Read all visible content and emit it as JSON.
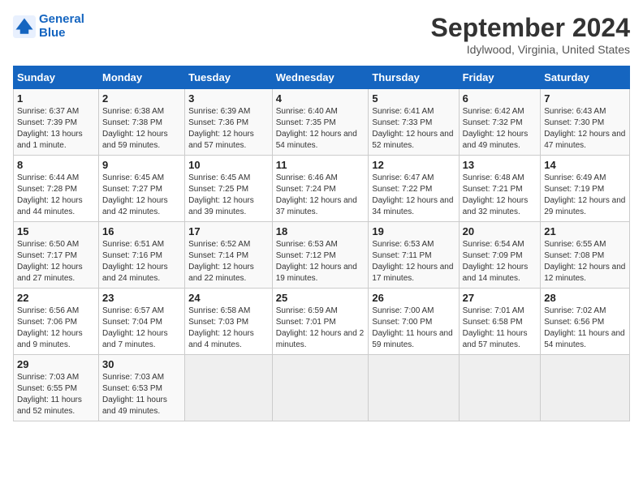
{
  "logo": {
    "line1": "General",
    "line2": "Blue"
  },
  "title": "September 2024",
  "subtitle": "Idylwood, Virginia, United States",
  "days_of_week": [
    "Sunday",
    "Monday",
    "Tuesday",
    "Wednesday",
    "Thursday",
    "Friday",
    "Saturday"
  ],
  "weeks": [
    [
      {
        "day": "1",
        "sunrise": "6:37 AM",
        "sunset": "7:39 PM",
        "daylight": "13 hours and 1 minute."
      },
      {
        "day": "2",
        "sunrise": "6:38 AM",
        "sunset": "7:38 PM",
        "daylight": "12 hours and 59 minutes."
      },
      {
        "day": "3",
        "sunrise": "6:39 AM",
        "sunset": "7:36 PM",
        "daylight": "12 hours and 57 minutes."
      },
      {
        "day": "4",
        "sunrise": "6:40 AM",
        "sunset": "7:35 PM",
        "daylight": "12 hours and 54 minutes."
      },
      {
        "day": "5",
        "sunrise": "6:41 AM",
        "sunset": "7:33 PM",
        "daylight": "12 hours and 52 minutes."
      },
      {
        "day": "6",
        "sunrise": "6:42 AM",
        "sunset": "7:32 PM",
        "daylight": "12 hours and 49 minutes."
      },
      {
        "day": "7",
        "sunrise": "6:43 AM",
        "sunset": "7:30 PM",
        "daylight": "12 hours and 47 minutes."
      }
    ],
    [
      {
        "day": "8",
        "sunrise": "6:44 AM",
        "sunset": "7:28 PM",
        "daylight": "12 hours and 44 minutes."
      },
      {
        "day": "9",
        "sunrise": "6:45 AM",
        "sunset": "7:27 PM",
        "daylight": "12 hours and 42 minutes."
      },
      {
        "day": "10",
        "sunrise": "6:45 AM",
        "sunset": "7:25 PM",
        "daylight": "12 hours and 39 minutes."
      },
      {
        "day": "11",
        "sunrise": "6:46 AM",
        "sunset": "7:24 PM",
        "daylight": "12 hours and 37 minutes."
      },
      {
        "day": "12",
        "sunrise": "6:47 AM",
        "sunset": "7:22 PM",
        "daylight": "12 hours and 34 minutes."
      },
      {
        "day": "13",
        "sunrise": "6:48 AM",
        "sunset": "7:21 PM",
        "daylight": "12 hours and 32 minutes."
      },
      {
        "day": "14",
        "sunrise": "6:49 AM",
        "sunset": "7:19 PM",
        "daylight": "12 hours and 29 minutes."
      }
    ],
    [
      {
        "day": "15",
        "sunrise": "6:50 AM",
        "sunset": "7:17 PM",
        "daylight": "12 hours and 27 minutes."
      },
      {
        "day": "16",
        "sunrise": "6:51 AM",
        "sunset": "7:16 PM",
        "daylight": "12 hours and 24 minutes."
      },
      {
        "day": "17",
        "sunrise": "6:52 AM",
        "sunset": "7:14 PM",
        "daylight": "12 hours and 22 minutes."
      },
      {
        "day": "18",
        "sunrise": "6:53 AM",
        "sunset": "7:12 PM",
        "daylight": "12 hours and 19 minutes."
      },
      {
        "day": "19",
        "sunrise": "6:53 AM",
        "sunset": "7:11 PM",
        "daylight": "12 hours and 17 minutes."
      },
      {
        "day": "20",
        "sunrise": "6:54 AM",
        "sunset": "7:09 PM",
        "daylight": "12 hours and 14 minutes."
      },
      {
        "day": "21",
        "sunrise": "6:55 AM",
        "sunset": "7:08 PM",
        "daylight": "12 hours and 12 minutes."
      }
    ],
    [
      {
        "day": "22",
        "sunrise": "6:56 AM",
        "sunset": "7:06 PM",
        "daylight": "12 hours and 9 minutes."
      },
      {
        "day": "23",
        "sunrise": "6:57 AM",
        "sunset": "7:04 PM",
        "daylight": "12 hours and 7 minutes."
      },
      {
        "day": "24",
        "sunrise": "6:58 AM",
        "sunset": "7:03 PM",
        "daylight": "12 hours and 4 minutes."
      },
      {
        "day": "25",
        "sunrise": "6:59 AM",
        "sunset": "7:01 PM",
        "daylight": "12 hours and 2 minutes."
      },
      {
        "day": "26",
        "sunrise": "7:00 AM",
        "sunset": "7:00 PM",
        "daylight": "11 hours and 59 minutes."
      },
      {
        "day": "27",
        "sunrise": "7:01 AM",
        "sunset": "6:58 PM",
        "daylight": "11 hours and 57 minutes."
      },
      {
        "day": "28",
        "sunrise": "7:02 AM",
        "sunset": "6:56 PM",
        "daylight": "11 hours and 54 minutes."
      }
    ],
    [
      {
        "day": "29",
        "sunrise": "7:03 AM",
        "sunset": "6:55 PM",
        "daylight": "11 hours and 52 minutes."
      },
      {
        "day": "30",
        "sunrise": "7:03 AM",
        "sunset": "6:53 PM",
        "daylight": "11 hours and 49 minutes."
      },
      null,
      null,
      null,
      null,
      null
    ]
  ],
  "labels": {
    "sunrise": "Sunrise: ",
    "sunset": "Sunset: ",
    "daylight": "Daylight: "
  }
}
